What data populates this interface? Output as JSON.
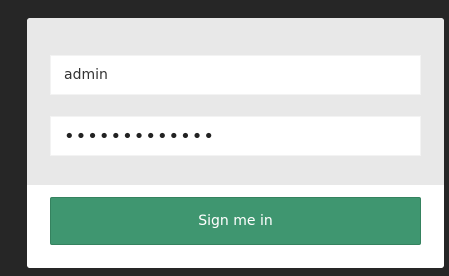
{
  "login_form": {
    "username_value": "admin",
    "password_value": "•••••••••••••",
    "submit_label": "Sign me in"
  },
  "colors": {
    "page_background": "#262626",
    "card_background": "#ffffff",
    "form_panel_background": "#e8e8e8",
    "submit_button": "#3f9670",
    "submit_text": "#ffffff"
  }
}
